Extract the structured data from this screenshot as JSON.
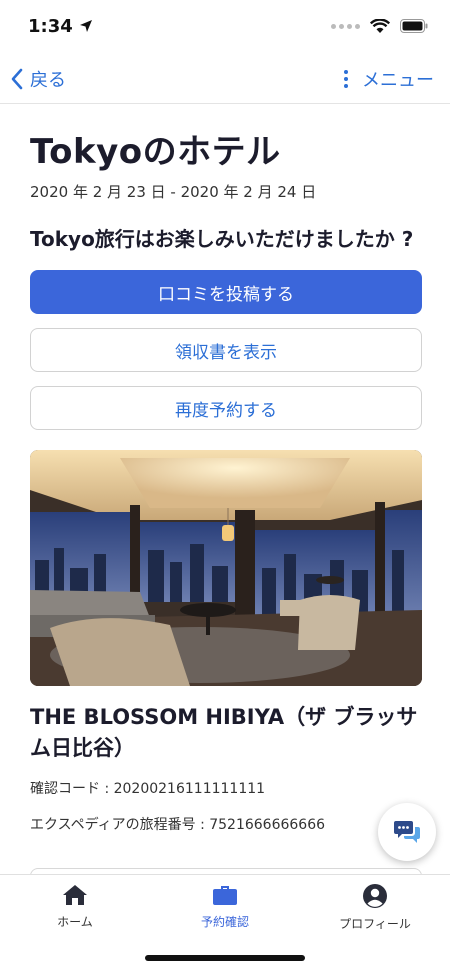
{
  "status": {
    "time": "1:34"
  },
  "nav": {
    "back_label": "戻る",
    "menu_label": "メニュー"
  },
  "trip": {
    "title": "Tokyoのホテル",
    "dates": "2020 年 2 月 23 日 - 2020 年 2 月 24 日",
    "question": "Tokyo旅行はお楽しみいただけましたか ?"
  },
  "actions": {
    "review": "口コミを投稿する",
    "receipt": "領収書を表示",
    "rebook": "再度予約する"
  },
  "hotel": {
    "name": "THE BLOSSOM HIBIYA（ザ ブラッサム日比谷）",
    "confirmation": "確認コード : 20200216111111111",
    "itinerary": "エクスペディアの旅程番号 : 7521666666666"
  },
  "tabs": [
    {
      "label": "ホーム",
      "icon": "home-icon"
    },
    {
      "label": "予約確認",
      "icon": "briefcase-icon"
    },
    {
      "label": "プロフィール",
      "icon": "account-icon"
    }
  ],
  "colors": {
    "accent": "#3b66da",
    "link": "#2c6fd6"
  }
}
